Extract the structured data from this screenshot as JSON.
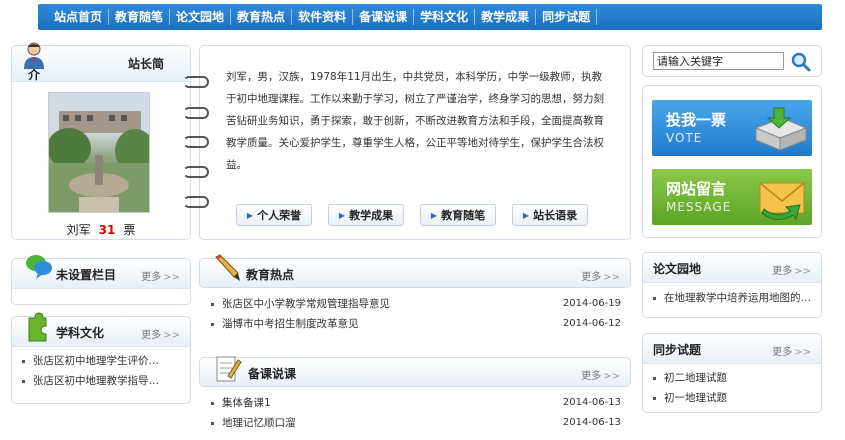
{
  "nav": [
    "站点首页",
    "教育随笔",
    "论文园地",
    "教育热点",
    "软件资料",
    "备课说课",
    "学科文化",
    "教学成果",
    "同步试题"
  ],
  "profile": {
    "title_right": "站长简",
    "title_left": "介",
    "name": "刘军",
    "votes": "31",
    "votes_unit": "票"
  },
  "intro": {
    "text": "刘军，男，汉族，1978年11月出生，中共党员，本科学历，中学一级教师，执教于初中地理课程。工作以来勤于学习，树立了严谨治学，终身学习的思想，努力刻苦钻研业务知识，勇于探索，敢于创新，不断改进教育方法和手段，全面提高教育教学质量。关心爱护学生，尊重学生人格，公正平等地对待学生，保护学生合法权益。",
    "buttons": [
      "个人荣誉",
      "教学成果",
      "教育随笔",
      "站长语录"
    ]
  },
  "search": {
    "placeholder": "请输入关键字"
  },
  "ads": {
    "vote": {
      "title": "投我一票",
      "sub": "VOTE",
      "color": "#2f8fd8"
    },
    "message": {
      "title": "网站留言",
      "sub": "MESSAGE",
      "color": "#6bb52e"
    }
  },
  "more_label": "更多",
  "left_sections": {
    "unset": {
      "title": "未设置栏目"
    },
    "culture": {
      "title": "学科文化",
      "items": [
        "张店区初中地理学生评价…",
        "张店区初中地理教学指导…"
      ]
    }
  },
  "hot": {
    "title": "教育热点",
    "items": [
      {
        "title": "张店区中小学教学常规管理指导意见",
        "date": "2014-06-19"
      },
      {
        "title": "淄博市中考招生制度改革意见",
        "date": "2014-06-12"
      }
    ]
  },
  "prep": {
    "title": "备课说课",
    "items": [
      {
        "title": "集体备课1",
        "date": "2014-06-13"
      },
      {
        "title": "地理记忆顺口溜",
        "date": "2014-06-13"
      }
    ]
  },
  "papers": {
    "title": "论文园地",
    "items": [
      "在地理教学中培养运用地图的…"
    ]
  },
  "tests": {
    "title": "同步试题",
    "items": [
      "初二地理试题",
      "初一地理试题"
    ]
  }
}
